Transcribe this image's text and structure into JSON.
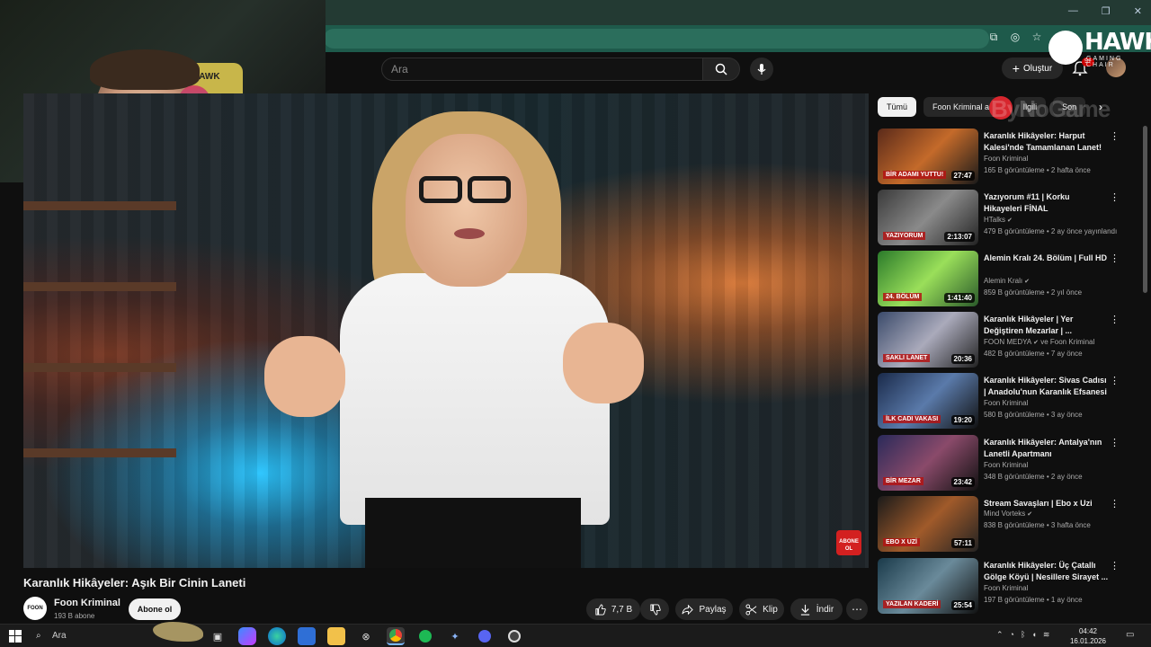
{
  "browser": {
    "window_controls": [
      "—",
      "❐",
      "✕"
    ],
    "addr_icons": [
      "tab-icon",
      "eye-off-icon",
      "star-icon"
    ]
  },
  "header": {
    "search_placeholder": "Ara",
    "create_label": "Oluştur",
    "notification_count": "9+"
  },
  "overlay": {
    "hawk_name": "HAWK",
    "hawk_sub": "GAMING CHAIR",
    "webcam_chair_text": "HAWK",
    "bynogame": "ByNoGame"
  },
  "video": {
    "title": "Karanlık Hikâyeler: Aşık Bir Cinin Laneti",
    "abone_badge": "ABONE OL",
    "channel": {
      "avatar_text": "FOON",
      "name": "Foon Kriminal",
      "subscribers": "193 B abone"
    },
    "subscribe_label": "Abone ol",
    "actions": {
      "likes": "7,7 B",
      "share": "Paylaş",
      "clip": "Klip",
      "download": "İndir"
    }
  },
  "sidebar": {
    "chips": [
      "Tümü",
      "Foon Kriminal adlı",
      "Ilgili",
      "Son"
    ],
    "recommendations": [
      {
        "title": "Karanlık Hikâyeler: Harput Kalesi'nde Tamamlanan Lanet!",
        "channel": "Foon Kriminal",
        "meta": "165 B görüntüleme • 2 hafta önce",
        "duration": "27:47",
        "caption": "BİR ADAMI YUTTU!",
        "verified": false
      },
      {
        "title": "Yazıyorum #11 | Korku Hikayeleri FİNAL",
        "channel": "HTalks",
        "meta": "479 B görüntüleme • 2 ay önce yayınlandı",
        "duration": "2:13:07",
        "caption": "YAZIYORUM",
        "verified": true
      },
      {
        "title": "Alemin Kralı 24. Bölüm | Full HD",
        "channel": "Alemin Kralı",
        "meta": "859 B görüntüleme • 2 yıl önce",
        "duration": "1:41:40",
        "caption": "24. BÖLÜM",
        "verified": true
      },
      {
        "title": "Karanlık Hikâyeler | Yer Değiştiren Mezarlar | ...",
        "channel": "FOON MEDYA",
        "channel_extra": "ve Foon Kriminal",
        "meta": "482 B görüntüleme • 7 ay önce",
        "duration": "20:36",
        "caption": "SAKLI LANET",
        "verified": true
      },
      {
        "title": "Karanlık Hikâyeler: Sivas Cadısı | Anadolu'nun Karanlık Efsanesi",
        "channel": "Foon Kriminal",
        "meta": "580 B görüntüleme • 3 ay önce",
        "duration": "19:20",
        "caption": "İLK CADI VAKASI",
        "verified": false
      },
      {
        "title": "Karanlık Hikâyeler: Antalya'nın Lanetli Apartmanı",
        "channel": "Foon Kriminal",
        "meta": "348 B görüntüleme • 2 ay önce",
        "duration": "23:42",
        "caption": "BİR MEZAR",
        "verified": false
      },
      {
        "title": "Stream Savaşları | Ebo x Uzi",
        "channel": "Mind Vorteks",
        "meta": "838 B görüntüleme • 3 hafta önce",
        "duration": "57:11",
        "caption": "EBO X UZİ",
        "verified": true
      },
      {
        "title": "Karanlık Hikâyeler: Üç Çatallı Gölge Köyü | Nesillere Sirayet ...",
        "channel": "Foon Kriminal",
        "meta": "197 B görüntüleme • 1 ay önce",
        "duration": "25:54",
        "caption": "YAZILAN KADERİ",
        "verified": false
      }
    ]
  },
  "taskbar": {
    "search_label": "Ara",
    "time": "04:42",
    "date": "16.01.2026"
  },
  "colors": {
    "accent_red": "#cc0000",
    "bg": "#0f0f0f",
    "chrome_green": "#1e5a4b"
  }
}
